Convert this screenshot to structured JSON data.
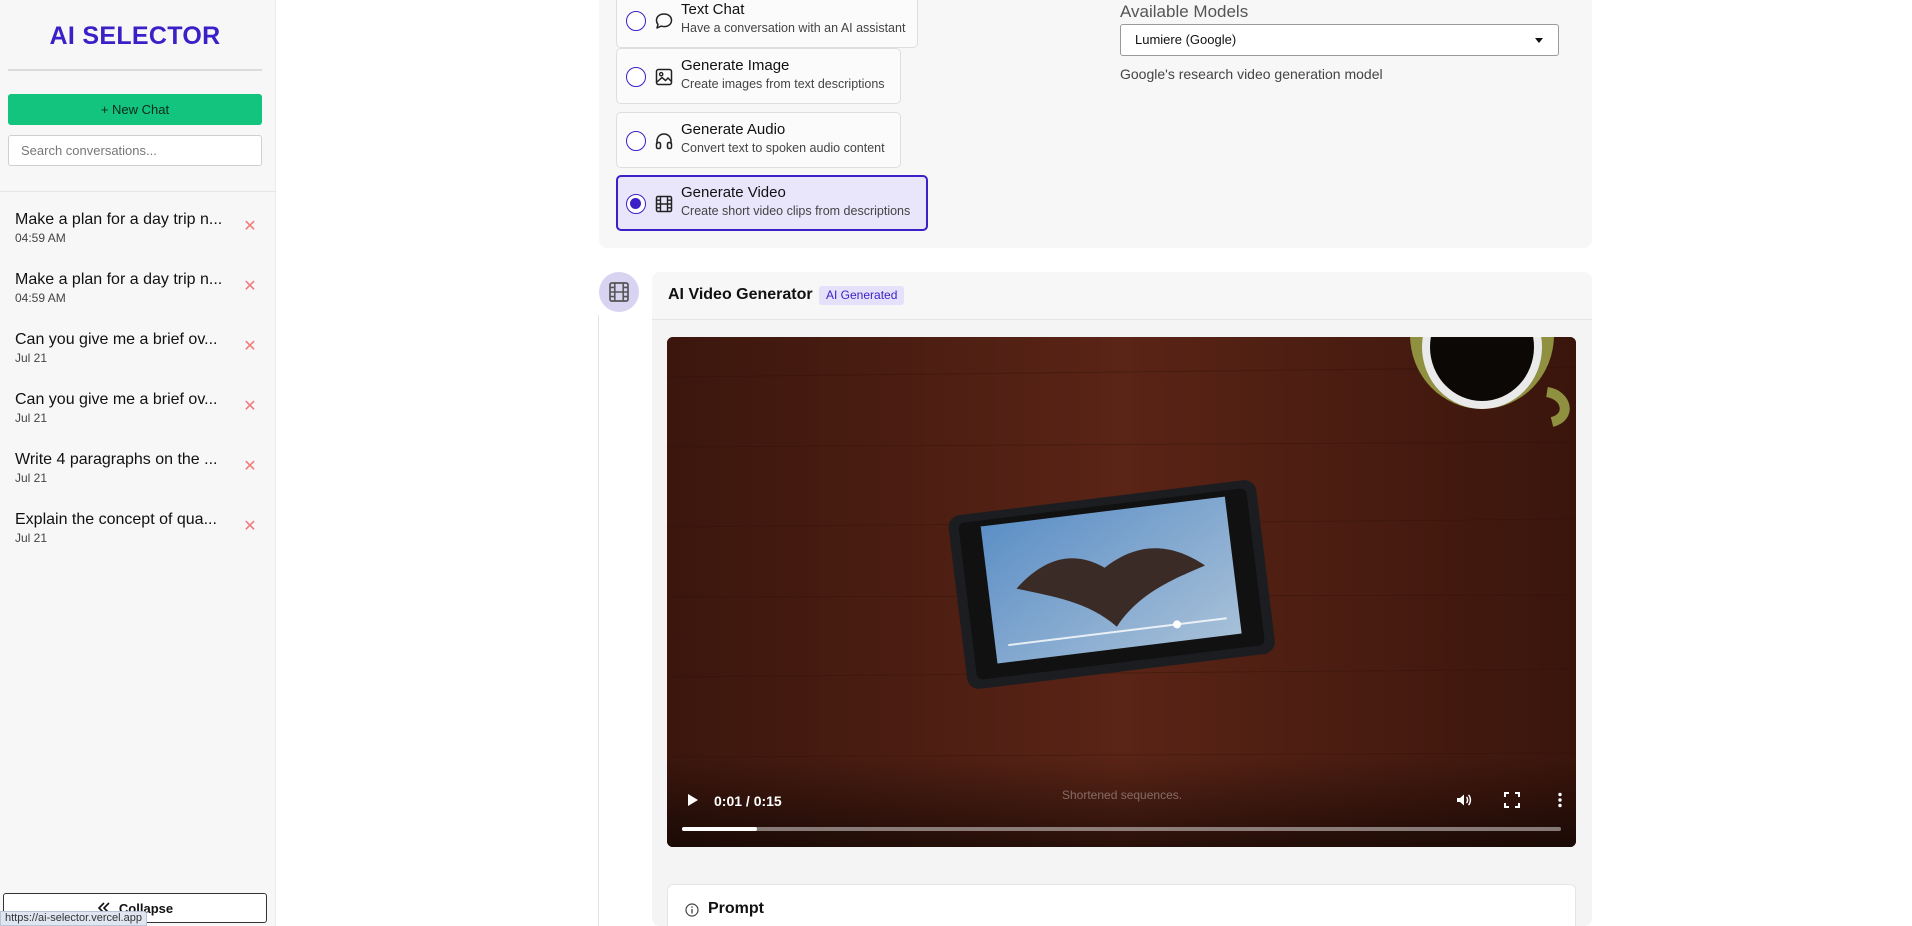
{
  "sidebar": {
    "brand": "AI SELECTOR",
    "new_chat_label": "+ New Chat",
    "search_placeholder": "Search conversations...",
    "conversations": [
      {
        "title": "Make a plan for a day trip n...",
        "time": "04:59 AM"
      },
      {
        "title": "Make a plan for a day trip n...",
        "time": "04:59 AM"
      },
      {
        "title": "Can you give me a brief ov...",
        "time": "Jul 21"
      },
      {
        "title": "Can you give me a brief ov...",
        "time": "Jul 21"
      },
      {
        "title": "Write 4 paragraphs on the ...",
        "time": "Jul 21"
      },
      {
        "title": "Explain the concept of qua...",
        "time": "Jul 21"
      }
    ],
    "delete_glyph": "✕",
    "collapse_label": "Collapse",
    "status_url": "https://ai-selector.vercel.app"
  },
  "modes": [
    {
      "label": "Text Chat",
      "description": "Have a conversation with an AI assistant",
      "icon": "chat-bubble-icon",
      "selected": false
    },
    {
      "label": "Generate Image",
      "description": "Create images from text descriptions",
      "icon": "image-icon",
      "selected": false
    },
    {
      "label": "Generate Audio",
      "description": "Convert text to spoken audio content",
      "icon": "headphones-icon",
      "selected": false
    },
    {
      "label": "Generate Video",
      "description": "Create short video clips from descriptions",
      "icon": "film-icon",
      "selected": true
    }
  ],
  "models": {
    "label": "Available Models",
    "selected": "Lumiere (Google)",
    "description": "Google's research video generation model"
  },
  "card": {
    "title": "AI Video Generator",
    "badge": "AI Generated",
    "video": {
      "time": "0:01 / 0:15",
      "caption": "Shortened sequences.",
      "progress": 0.085
    },
    "prompt_label": "Prompt"
  },
  "colors": {
    "accent": "#3b1fc7",
    "new_chat": "#12c47d",
    "delete": "#f07b7b",
    "selected_mode_bg": "#e9e6fb"
  }
}
